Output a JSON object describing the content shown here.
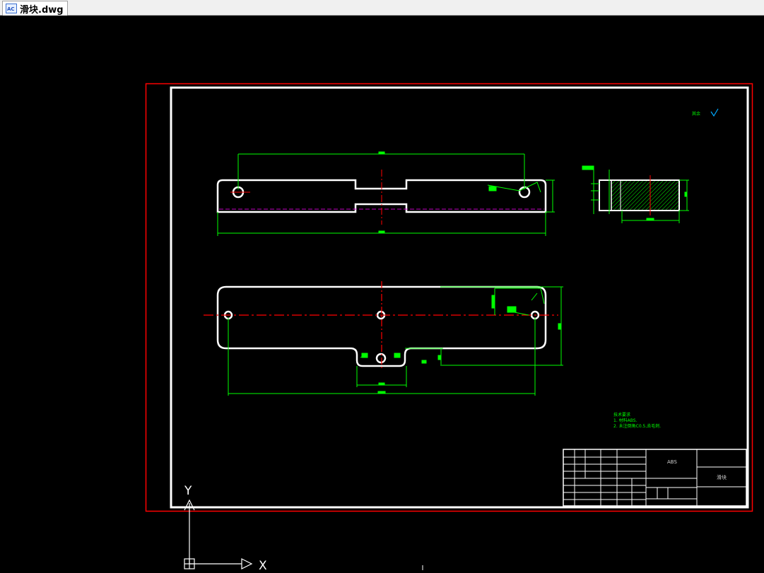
{
  "window": {
    "tab_title": "滑块.dwg",
    "tab_icon": "dwg-file-icon"
  },
  "drawing": {
    "background_color": "#000000",
    "layout_frame_color": "#ff0000",
    "border_color": "#ffffff",
    "dimension_color": "#00ff00",
    "centerline_color": "#ff0000",
    "hidden_line_color": "#c000c0",
    "roughness_note": "其余",
    "technical_requirements": {
      "title": "技术要求",
      "item1": "1. 材料ABS.",
      "item2": "2. 未注倒角C0.5,去毛刺."
    },
    "title_block": {
      "material": "ABS",
      "part_name": "滑块"
    },
    "ucs": {
      "x_label": "X",
      "y_label": "Y"
    }
  }
}
